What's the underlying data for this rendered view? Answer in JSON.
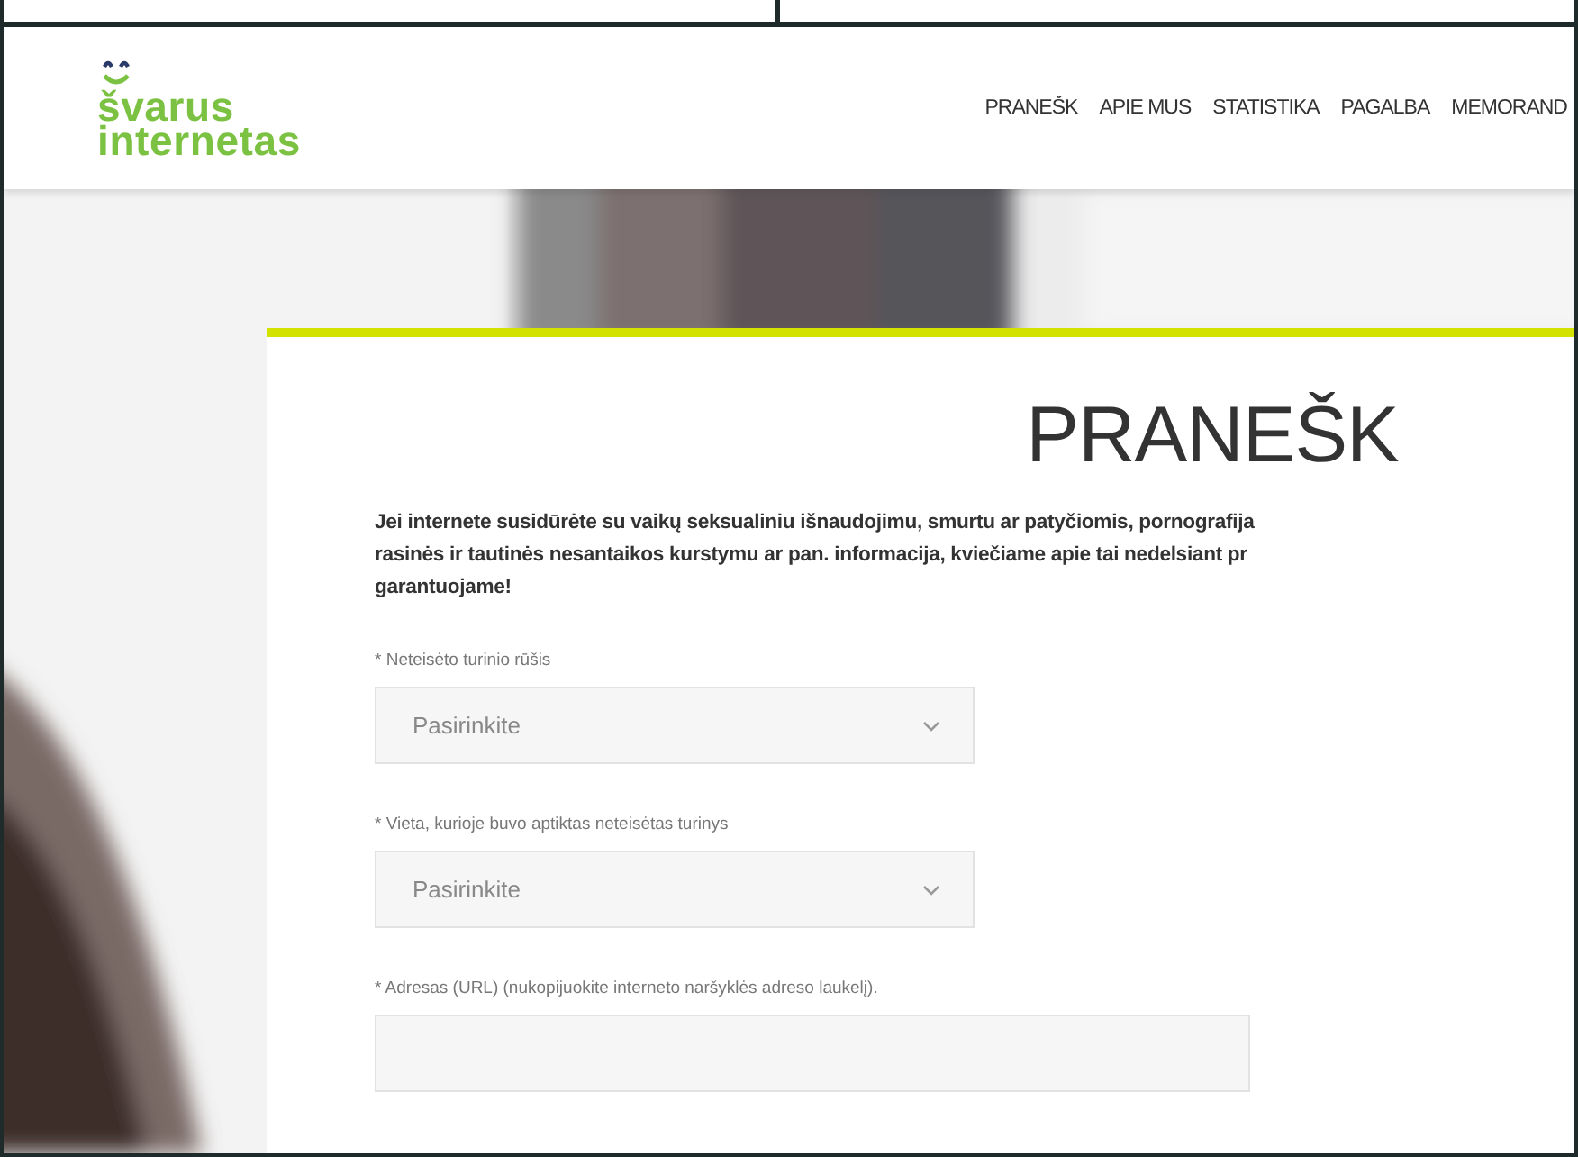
{
  "logo": {
    "lines": [
      "švarus",
      "internetas"
    ]
  },
  "nav": [
    {
      "label": "PRANEŠK"
    },
    {
      "label": "APIE MUS"
    },
    {
      "label": "STATISTIKA"
    },
    {
      "label": "PAGALBA"
    },
    {
      "label": "MEMORAND"
    }
  ],
  "form": {
    "title": "PRANEŠK",
    "intro": [
      "Jei internete susidūrėte su vaikų seksualiniu išnaudojimu, smurtu ar patyčiomis, pornografija",
      "rasinės ir tautinės nesantaikos kurstymu ar pan. informacija, kviečiame apie tai nedelsiant pr",
      "garantuojame!"
    ],
    "fields": [
      {
        "kind": "select",
        "label": "* Neteisėto turinio rūšis",
        "value": "Pasirinkite"
      },
      {
        "kind": "select",
        "label": "* Vieta, kurioje buvo aptiktas neteisėtas turinys",
        "value": "Pasirinkite"
      },
      {
        "kind": "text",
        "label": "* Adresas (URL) (nukopijuokite interneto naršyklės adreso laukelį)."
      }
    ]
  }
}
